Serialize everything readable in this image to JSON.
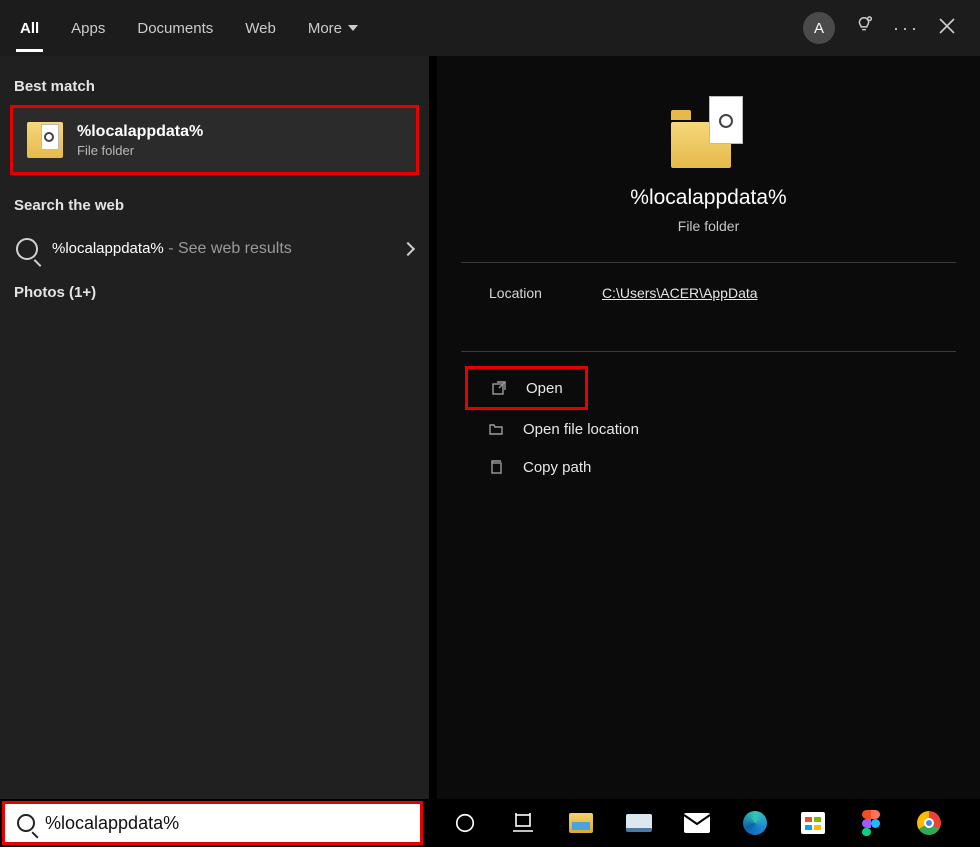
{
  "header": {
    "tabs": [
      "All",
      "Apps",
      "Documents",
      "Web",
      "More"
    ],
    "active_tab_index": 0,
    "avatar_initial": "A"
  },
  "left": {
    "section_best": "Best match",
    "best_match": {
      "title": "%localappdata%",
      "subtitle": "File folder"
    },
    "section_web": "Search the web",
    "web_result": {
      "query": "%localappdata%",
      "hint": " - See web results"
    },
    "section_photos": "Photos (1+)"
  },
  "preview": {
    "title": "%localappdata%",
    "subtitle": "File folder",
    "location_label": "Location",
    "location_value": "C:\\Users\\ACER\\AppData",
    "actions": {
      "open": "Open",
      "open_file_location": "Open file location",
      "copy_path": "Copy path"
    }
  },
  "search": {
    "value": "%localappdata%"
  }
}
